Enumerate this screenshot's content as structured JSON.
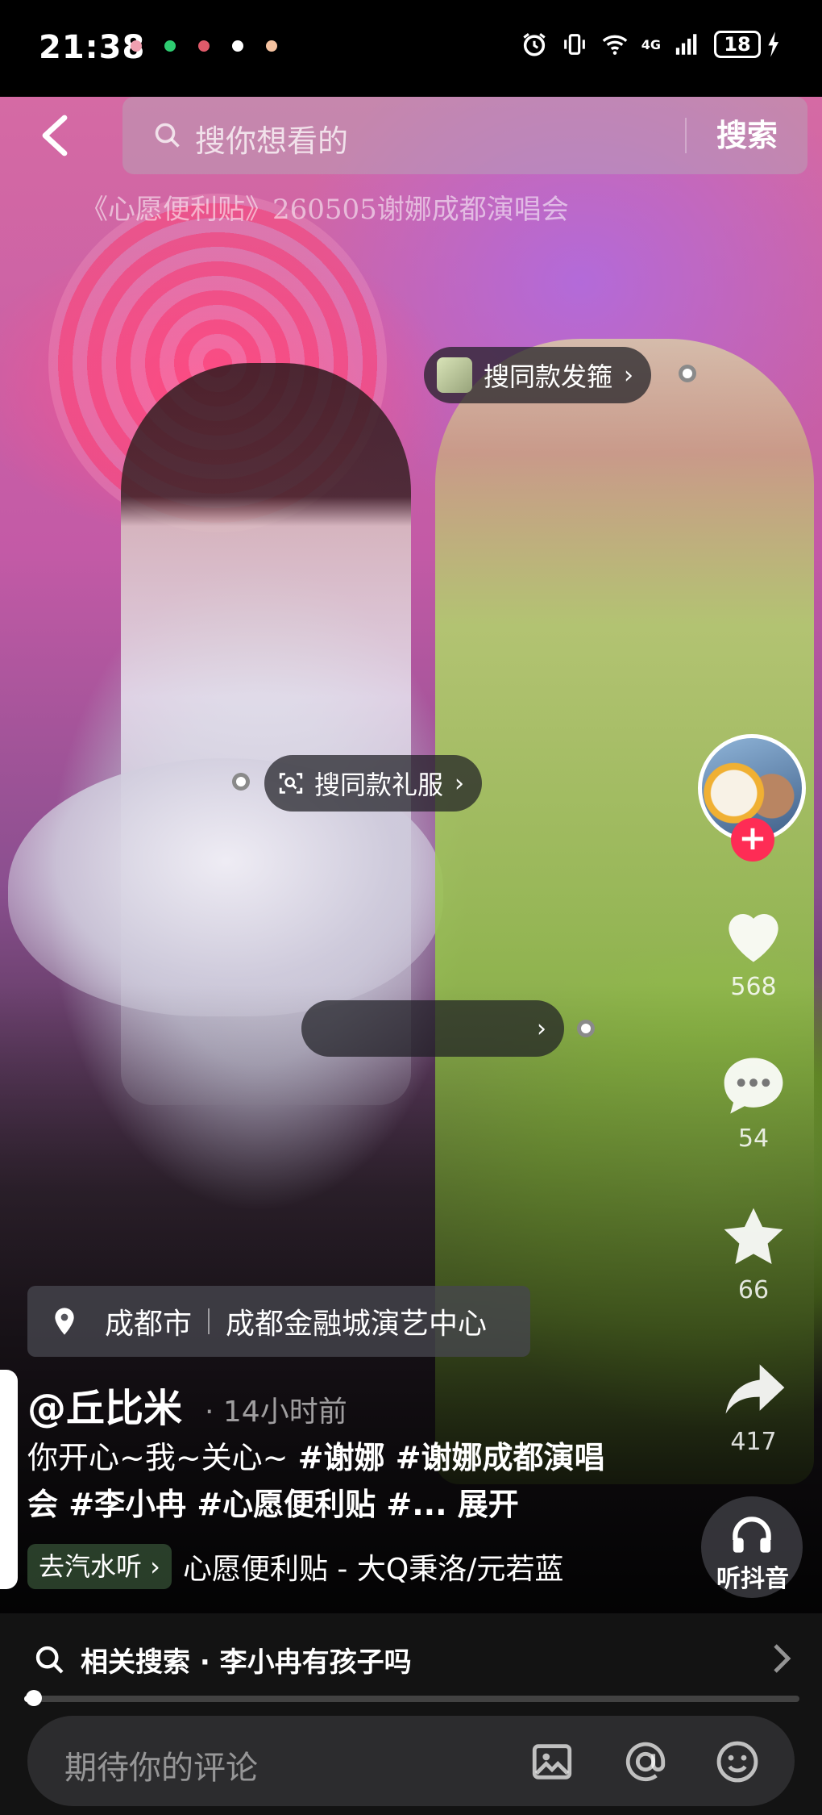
{
  "status_bar": {
    "time": "21:38",
    "network": "4G",
    "battery": "18",
    "notification_dot_colors": [
      "#f0a0b0",
      "#2ecc71",
      "#e05a6a",
      "#ffffff",
      "#f5c2a0"
    ]
  },
  "search": {
    "placeholder": "搜你想看的",
    "button_label": "搜索"
  },
  "video": {
    "overlay_caption": "《心愿便利贴》260505谢娜成都演唱会"
  },
  "product_tags": [
    {
      "label": "搜同款发箍",
      "arrow": "›"
    },
    {
      "label": "搜同款礼服",
      "arrow": "›"
    },
    {
      "label": "",
      "arrow": "›"
    }
  ],
  "rail": {
    "follow_label": "+",
    "likes": "568",
    "comments": "54",
    "favorites": "66",
    "shares": "417",
    "music_label": "听抖音"
  },
  "post": {
    "location_city": "成都市",
    "location_venue": "成都金融城演艺中心",
    "author": "@丘比米",
    "time_ago": "· 14小时前",
    "desc_text": "你开心~我~关心~ ",
    "hashtag_1": "#谢娜",
    "hashtag_2": "#谢娜成都演唱会",
    "hashtag_3": "#李小冉",
    "hashtag_4": "#心愿便利贴",
    "hashtag_5": "#...",
    "expand_label": "展开",
    "music_chip": "去汽水听 ›",
    "music_title": "心愿便利贴 - 大Q秉洛/元若蓝"
  },
  "related_search": {
    "label": "相关搜索 · 李小冉有孩子吗"
  },
  "progress": {
    "value": 0.01
  },
  "comment_bar": {
    "placeholder": "期待你的评论"
  },
  "colors": {
    "accent": "#fe2c55",
    "bar_background": "#131313",
    "input_background": "#2c2c2e"
  }
}
